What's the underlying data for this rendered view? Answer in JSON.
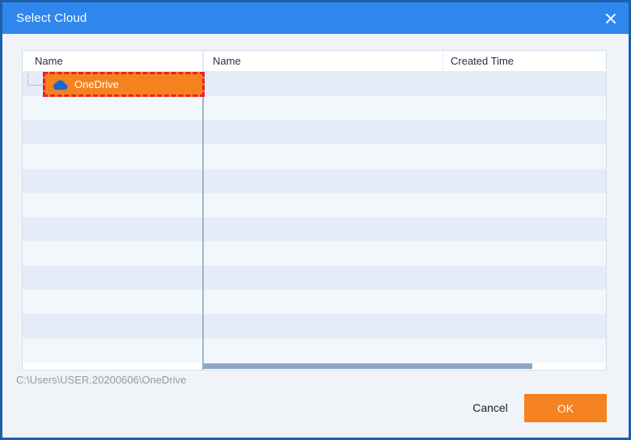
{
  "window": {
    "title": "Select Cloud"
  },
  "left_pane": {
    "header": "Name",
    "items": [
      {
        "label": "OneDrive",
        "icon": "onedrive-cloud-icon",
        "selected": true
      }
    ]
  },
  "right_pane": {
    "headers": [
      "Name",
      "Created Time"
    ],
    "rows": []
  },
  "scrollbar": {
    "orientation": "horizontal",
    "thumb_extent": "left ~82% of track"
  },
  "footer": {
    "path": "C:\\Users\\USER.20200606\\OneDrive"
  },
  "buttons": {
    "cancel": "Cancel",
    "ok": "OK"
  },
  "icons": {
    "close": "close-icon (white x, title bar)",
    "onedrive": "blue cloud glyph"
  },
  "colors": {
    "titlebar_bg": "#2F86EC",
    "window_border": "#1E5FA9",
    "content_bg": "#F0F4F9",
    "panel_border": "#D5DEE9",
    "stripe_dark": "#E4EDF7",
    "stripe_light": "#F2F7FC",
    "divider": "#9FB4CC",
    "selection_fill": "#F5821F",
    "selection_outline": "#E9202B",
    "accent_orange": "#F5821F",
    "scroll_thumb": "#8CA7C7",
    "path_text": "#9399A4",
    "onedrive_icon_blue": "#1B66C9"
  }
}
